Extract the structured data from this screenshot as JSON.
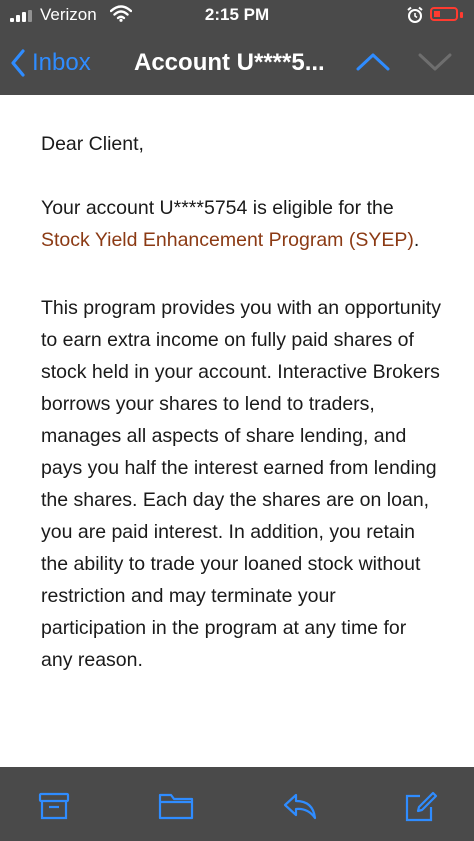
{
  "status_bar": {
    "carrier": "Verizon",
    "time": "2:15 PM"
  },
  "nav": {
    "back_label": "Inbox",
    "title": "Account U****5..."
  },
  "email": {
    "greeting": "Dear Client,",
    "p1_prefix": "Your account U****5754 is eligible for the",
    "p1_link": "Stock Yield Enhancement Program (SYEP)",
    "p1_suffix": ".",
    "p2": "This program provides you with an opportunity to earn extra income on fully paid shares of stock held in your account. Interactive Brokers borrows your shares to lend to traders, manages all aspects of share lending, and pays you half the interest earned from lending the shares. Each day the shares are on loan, you are paid interest. In addition, you retain the ability to trade your loaned stock without restriction and may terminate your participation in the program at any time for any reason."
  },
  "colors": {
    "bar_background": "#4a4a4a",
    "accent_blue": "#2f8cff",
    "link_color": "#8b3a14",
    "battery_red": "#ff3b30"
  },
  "icons": [
    "signal-icon",
    "wifi-icon",
    "alarm-icon",
    "battery-icon",
    "chevron-left-icon",
    "chevron-up-icon",
    "chevron-down-icon",
    "archive-icon",
    "folder-icon",
    "reply-icon",
    "compose-icon"
  ]
}
